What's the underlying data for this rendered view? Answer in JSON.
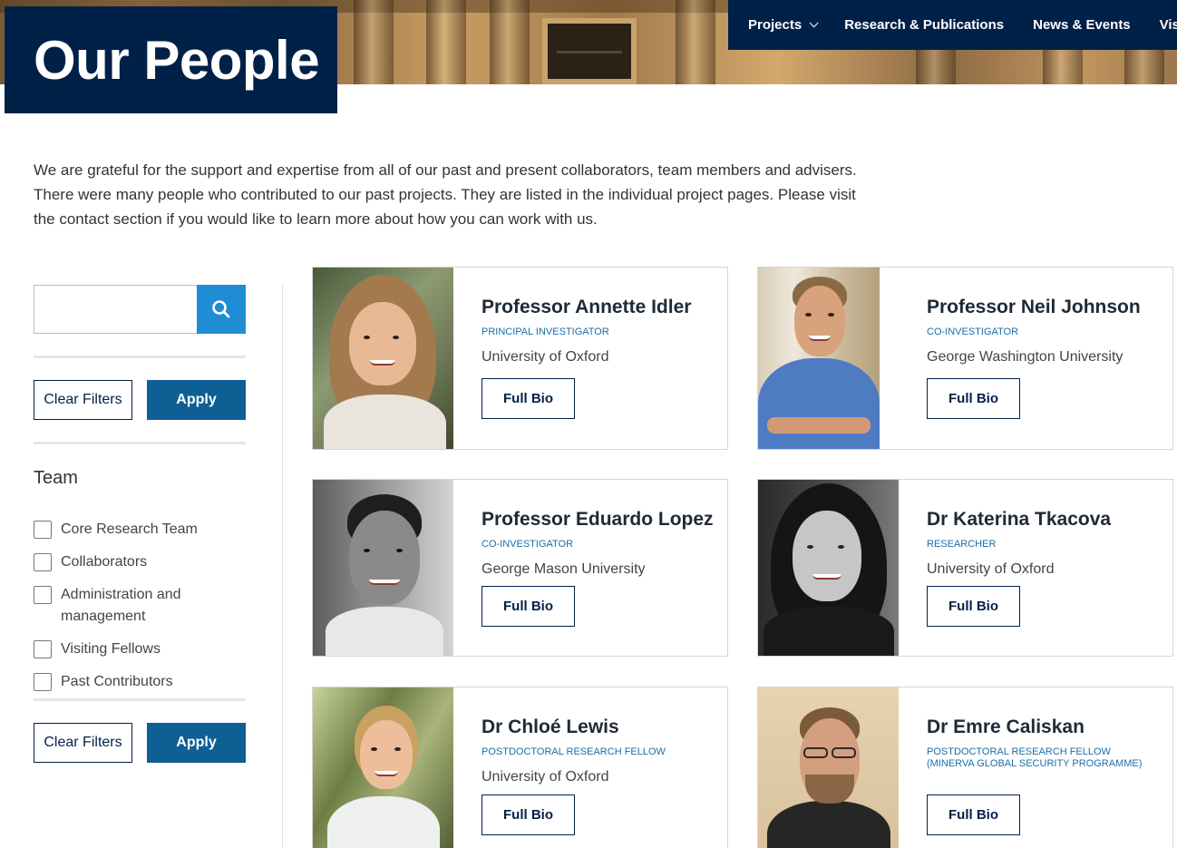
{
  "header": {
    "page_title": "Our People",
    "nav": [
      {
        "label": "Projects",
        "has_dropdown": true
      },
      {
        "label": "Research & Publications"
      },
      {
        "label": "News & Events"
      },
      {
        "label": "Visit"
      }
    ]
  },
  "intro": "We are grateful for the support and expertise from all of our past and present collaborators, team members and advisers. There were many people who contributed to our past projects. They are listed in the individual project pages. Please visit the contact section if you would like to learn more about how you can work with us.",
  "sidebar": {
    "search": {
      "value": "",
      "placeholder": "",
      "icon": "search-icon"
    },
    "clear_label": "Clear Filters",
    "apply_label": "Apply",
    "team_heading": "Team",
    "filters": [
      {
        "label": "Core Research Team",
        "checked": false
      },
      {
        "label": "Collaborators",
        "checked": false
      },
      {
        "label": "Administration and management",
        "checked": false
      },
      {
        "label": "Visiting Fellows",
        "checked": false
      },
      {
        "label": "Past Contributors",
        "checked": false
      }
    ]
  },
  "people": [
    {
      "name": "Professor Annette Idler",
      "role": "Principal Investigator",
      "org": "University of Oxford",
      "bio_label": "Full Bio"
    },
    {
      "name": "Professor Neil Johnson",
      "role": "Co-Investigator",
      "org": "George Washington University",
      "bio_label": "Full Bio"
    },
    {
      "name": "Professor Eduardo Lopez",
      "role": "Co-Investigator",
      "org": "George Mason University",
      "bio_label": "Full Bio"
    },
    {
      "name": "Dr Katerina Tkacova",
      "role": "Researcher",
      "org": "University of Oxford",
      "bio_label": "Full Bio"
    },
    {
      "name": "Dr Chloé Lewis",
      "role": "Postdoctoral Research Fellow",
      "org": "University of Oxford",
      "bio_label": "Full Bio"
    },
    {
      "name": "Dr Emre Caliskan",
      "role": "Postdoctoral Research Fellow (Minerva Global Security Programme)",
      "org": "",
      "bio_label": "Full Bio"
    }
  ],
  "colors": {
    "navy": "#002147",
    "apply_blue": "#0e5f94",
    "search_blue": "#1f8dd6",
    "role_blue": "#1a6ea8"
  }
}
